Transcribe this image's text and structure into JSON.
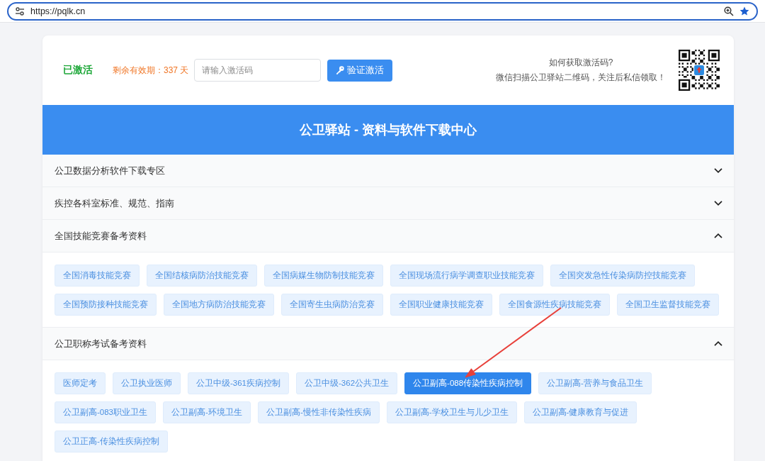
{
  "browser": {
    "url": "https://pqlk.cn"
  },
  "activation": {
    "status": "已激活",
    "remaining": "剩余有效期：337 天",
    "code_field": {
      "placeholder": "请输入激活码"
    },
    "verify_button": "验证激活",
    "help": [
      "如何获取激活码?",
      "微信扫描公卫驿站二维码，关注后私信领取！"
    ]
  },
  "banner": {
    "title": "公卫驿站 - 资料与软件下载中心"
  },
  "sections": [
    {
      "title": "公卫数据分析软件下载专区",
      "expanded": false
    },
    {
      "title": "疾控各科室标准、规范、指南",
      "expanded": false
    },
    {
      "title": "全国技能竞赛备考资料",
      "expanded": true,
      "items": [
        {
          "label": "全国消毒技能竞赛",
          "selected": false
        },
        {
          "label": "全国结核病防治技能竞赛",
          "selected": false
        },
        {
          "label": "全国病媒生物防制技能竞赛",
          "selected": false
        },
        {
          "label": "全国现场流行病学调查职业技能竞赛",
          "selected": false
        },
        {
          "label": "全国突发急性传染病防控技能竞赛",
          "selected": false
        },
        {
          "label": "全国预防接种技能竞赛",
          "selected": false
        },
        {
          "label": "全国地方病防治技能竞赛",
          "selected": false
        },
        {
          "label": "全国寄生虫病防治竞赛",
          "selected": false
        },
        {
          "label": "全国职业健康技能竞赛",
          "selected": false
        },
        {
          "label": "全国食源性疾病技能竞赛",
          "selected": false
        },
        {
          "label": "全国卫生监督技能竞赛",
          "selected": false
        }
      ]
    },
    {
      "title": "公卫职称考试备考资料",
      "expanded": true,
      "items": [
        {
          "label": "医师定考",
          "selected": false
        },
        {
          "label": "公卫执业医师",
          "selected": false
        },
        {
          "label": "公卫中级-361疾病控制",
          "selected": false
        },
        {
          "label": "公卫中级-362公共卫生",
          "selected": false
        },
        {
          "label": "公卫副高-088传染性疾病控制",
          "selected": true
        },
        {
          "label": "公卫副高-营养与食品卫生",
          "selected": false
        },
        {
          "label": "公卫副高-083职业卫生",
          "selected": false
        },
        {
          "label": "公卫副高-环境卫生",
          "selected": false
        },
        {
          "label": "公卫副高-慢性非传染性疾病",
          "selected": false
        },
        {
          "label": "公卫副高-学校卫生与儿少卫生",
          "selected": false
        },
        {
          "label": "公卫副高-健康教育与促进",
          "selected": false
        },
        {
          "label": "公卫正高-传染性疾病控制",
          "selected": false
        }
      ]
    }
  ]
}
